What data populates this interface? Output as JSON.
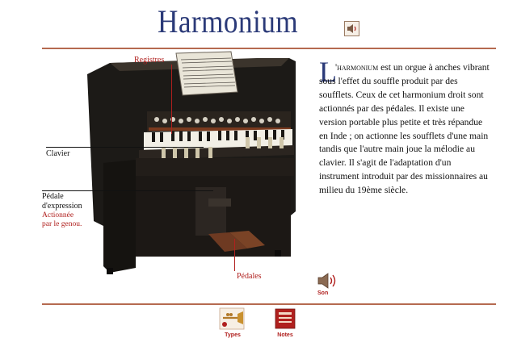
{
  "title": "Harmonium",
  "callouts": {
    "registres": "Registres",
    "clavier": "Clavier",
    "pedale_expression_line1": "Pédale",
    "pedale_expression_line2": "d'expression",
    "pedale_expression_note1": "Actionnée",
    "pedale_expression_note2": "par le genou.",
    "pedales": "Pédales"
  },
  "body": {
    "dropcap": "L",
    "smallcaps": "'harmonium",
    "text": " est un orgue à anches vibrant sous l'effet du souffle produit par des soufflets. Ceux de cet harmonium droit sont actionnés par des pédales. Il existe une version portable plus petite et très répandue en Inde ; on actionne les soufflets d'une main tandis que l'autre main joue la mélodie au clavier. Il s'agit de l'adaptation d'un instrument introduit par des missionnaires au milieu du 19ème siècle."
  },
  "buttons": {
    "son": "Son",
    "types": "Types",
    "notes": "Notes"
  },
  "icons": {
    "title_sound": "speaker-icon",
    "son": "speaker-icon",
    "types": "trumpet-icon",
    "notes": "notes-book-icon"
  },
  "colors": {
    "title": "#2b3a78",
    "rule": "#b56a50",
    "accent_red": "#b0201e"
  }
}
